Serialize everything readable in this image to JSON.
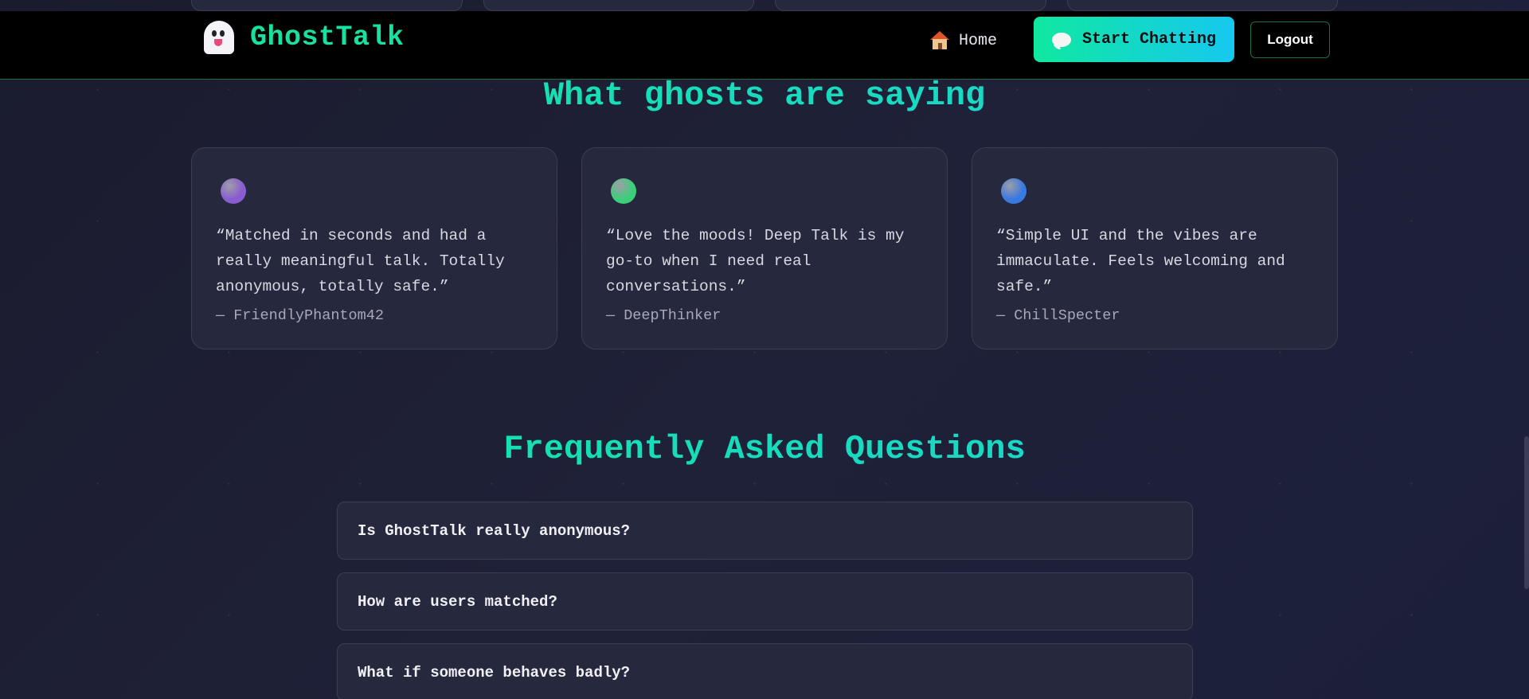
{
  "navbar": {
    "brand": "GhostTalk",
    "home_label": "Home",
    "start_label": "Start Chatting",
    "logout_label": "Logout"
  },
  "testimonials": {
    "title": "What ghosts are saying",
    "items": [
      {
        "quote": "“Matched in seconds and had a really meaningful talk. Totally anonymous, totally safe.”",
        "author": "— FriendlyPhantom42",
        "avatar_color": "#8a5cd0"
      },
      {
        "quote": "“Love the moods! Deep Talk is my go-to when I need real conversations.”",
        "author": "— DeepThinker",
        "avatar_color": "#3ccf7a"
      },
      {
        "quote": "“Simple UI and the vibes are immaculate. Feels welcoming and safe.”",
        "author": "— ChillSpecter",
        "avatar_color": "#3a7ae0"
      }
    ]
  },
  "faq": {
    "title": "Frequently Asked Questions",
    "items": [
      {
        "question": "Is GhostTalk really anonymous?"
      },
      {
        "question": "How are users matched?"
      },
      {
        "question": "What if someone behaves badly?"
      }
    ]
  },
  "colors": {
    "accent": "#18e0a0",
    "accent_end": "#16c8f0",
    "background": "#1f2138",
    "card": "#26283d"
  }
}
